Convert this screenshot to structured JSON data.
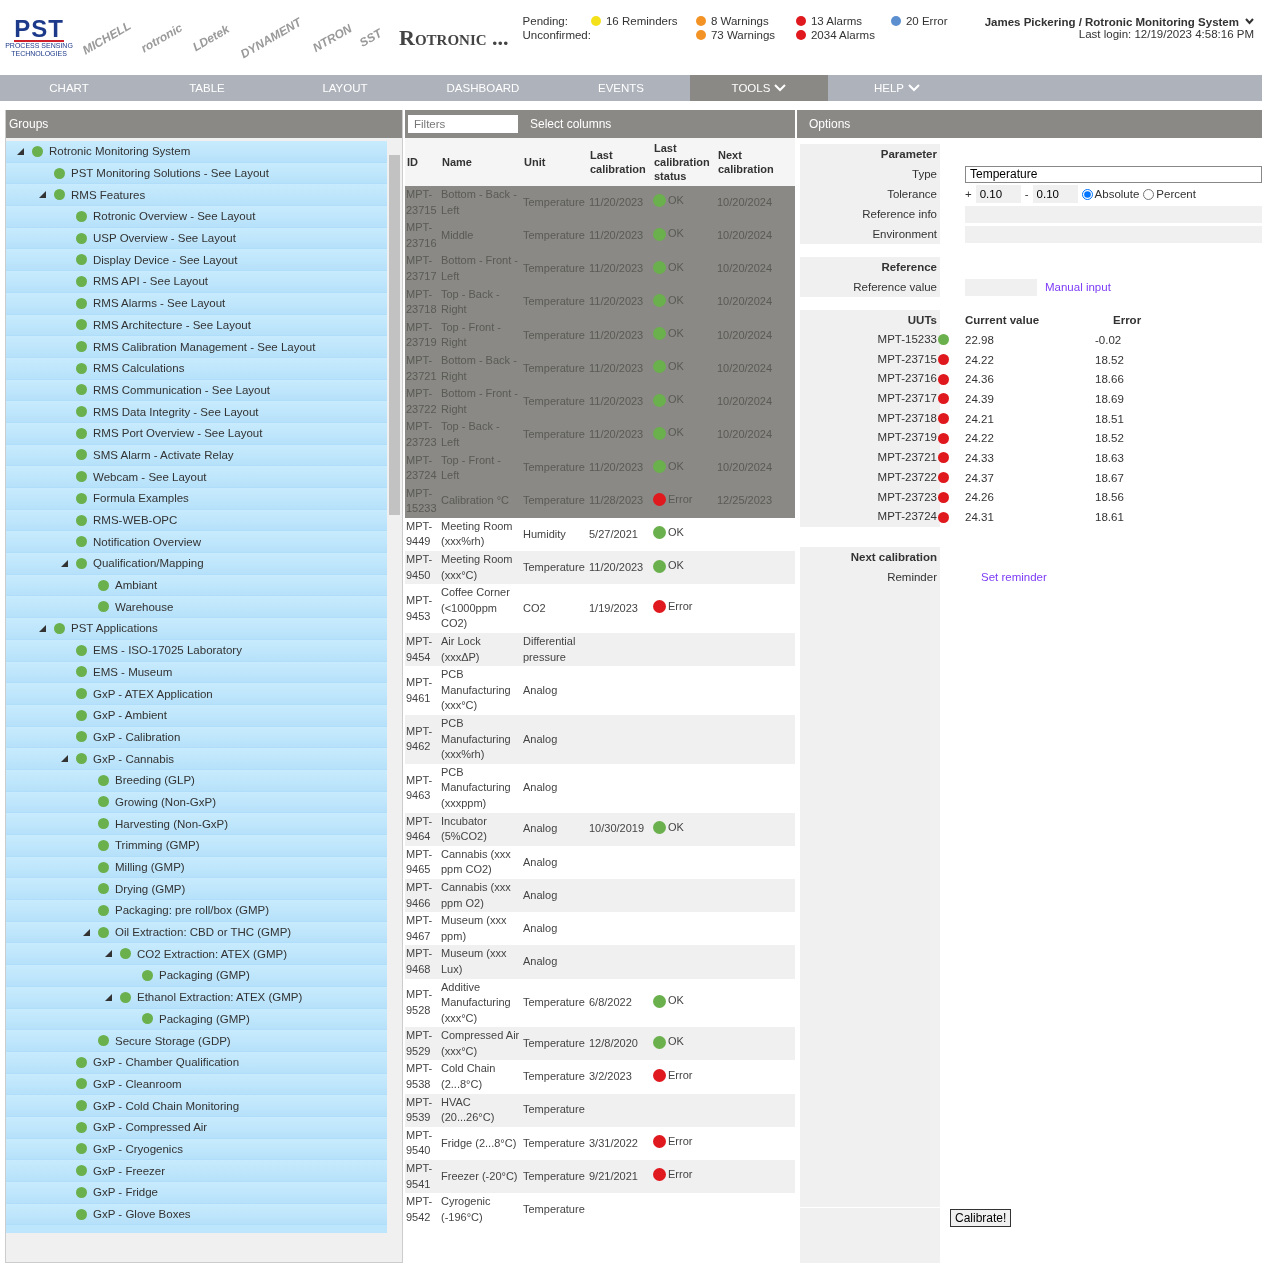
{
  "header": {
    "logos": [
      {
        "text": "PST",
        "sub": "PROCESS SENSING TECHNOLOGIES",
        "kind": "main"
      },
      {
        "text": "MICHELL",
        "kind": "tilt"
      },
      {
        "text": "rotronic",
        "kind": "tilt"
      },
      {
        "text": "LDetek",
        "kind": "tilt"
      },
      {
        "text": "DYNAMENT",
        "kind": "tilt"
      },
      {
        "text": "NTRON",
        "kind": "tilt"
      },
      {
        "text": "SST",
        "kind": "tilt"
      }
    ],
    "title": "Rotronic ...",
    "counters": [
      {
        "label": "Pending:",
        "items": [
          {
            "kind": "reminders",
            "text": "16 Reminders",
            "color": "#f5e11a"
          },
          {
            "kind": "warnings",
            "text": "8 Warnings",
            "color": "#f39325"
          },
          {
            "kind": "alarms",
            "text": "13 Alarms",
            "color": "#e0191e"
          },
          {
            "kind": "errors",
            "text": "20 Error",
            "color": "#5b8fd0"
          }
        ]
      },
      {
        "label": "Unconfirmed:",
        "items": [
          {
            "kind": "warnings",
            "text": "73 Warnings",
            "color": "#f39325"
          },
          {
            "kind": "alarms",
            "text": "2034 Alarms",
            "color": "#e0191e"
          }
        ]
      }
    ],
    "user": "James Pickering / Rotronic Monitoring System",
    "last_login": "Last login: 12/19/2023 4:58:16 PM"
  },
  "nav": [
    {
      "label": "CHART",
      "selected": false
    },
    {
      "label": "TABLE",
      "selected": false
    },
    {
      "label": "LAYOUT",
      "selected": false
    },
    {
      "label": "DASHBOARD",
      "selected": false
    },
    {
      "label": "EVENTS",
      "selected": false
    },
    {
      "label": "TOOLS",
      "selected": true,
      "menu": true
    },
    {
      "label": "HELP",
      "selected": false,
      "menu": true
    }
  ],
  "groups": {
    "title": "Groups",
    "tree": [
      {
        "label": "Rotronic Monitoring System",
        "expanded": true,
        "children": [
          {
            "label": "PST Monitoring Solutions - See Layout"
          },
          {
            "label": "RMS Features",
            "expanded": true,
            "children": [
              {
                "label": "Rotronic Overview - See Layout"
              },
              {
                "label": "USP Overview - See Layout"
              },
              {
                "label": "Display Device - See Layout"
              },
              {
                "label": "RMS API - See Layout"
              },
              {
                "label": "RMS Alarms - See Layout"
              },
              {
                "label": "RMS Architecture - See Layout"
              },
              {
                "label": "RMS Calibration Management - See Layout"
              },
              {
                "label": "RMS Calculations"
              },
              {
                "label": "RMS Communication - See Layout"
              },
              {
                "label": "RMS Data Integrity - See Layout"
              },
              {
                "label": "RMS Port Overview - See Layout"
              },
              {
                "label": "SMS Alarm - Activate Relay"
              },
              {
                "label": "Webcam - See Layout"
              },
              {
                "label": "Formula Examples"
              },
              {
                "label": "RMS-WEB-OPC"
              },
              {
                "label": "Notification Overview"
              },
              {
                "label": "Qualification/Mapping",
                "expanded": true,
                "children": [
                  {
                    "label": "Ambiant"
                  },
                  {
                    "label": "Warehouse"
                  }
                ]
              }
            ]
          },
          {
            "label": "PST Applications",
            "expanded": true,
            "children": [
              {
                "label": "EMS - ISO-17025 Laboratory"
              },
              {
                "label": "EMS - Museum"
              },
              {
                "label": "GxP - ATEX Application"
              },
              {
                "label": "GxP - Ambient"
              },
              {
                "label": "GxP - Calibration"
              },
              {
                "label": "GxP - Cannabis",
                "expanded": true,
                "children": [
                  {
                    "label": "Breeding (GLP)"
                  },
                  {
                    "label": "Growing (Non-GxP)"
                  },
                  {
                    "label": "Harvesting (Non-GxP)"
                  },
                  {
                    "label": "Trimming (GMP)"
                  },
                  {
                    "label": "Milling (GMP)"
                  },
                  {
                    "label": "Drying (GMP)"
                  },
                  {
                    "label": "Packaging: pre roll/box (GMP)"
                  },
                  {
                    "label": "Oil Extraction: CBD or THC (GMP)",
                    "expanded": true,
                    "children": [
                      {
                        "label": "CO2 Extraction: ATEX (GMP)",
                        "expanded": true,
                        "children": [
                          {
                            "label": "Packaging (GMP)"
                          }
                        ]
                      },
                      {
                        "label": "Ethanol Extraction: ATEX (GMP)",
                        "expanded": true,
                        "children": [
                          {
                            "label": "Packaging (GMP)"
                          }
                        ]
                      }
                    ]
                  },
                  {
                    "label": "Secure Storage (GDP)"
                  }
                ]
              },
              {
                "label": "GxP - Chamber Qualification"
              },
              {
                "label": "GxP - Cleanroom"
              },
              {
                "label": "GxP - Cold Chain Monitoring"
              },
              {
                "label": "GxP - Compressed Air"
              },
              {
                "label": "GxP - Cryogenics"
              },
              {
                "label": "GxP - Freezer"
              },
              {
                "label": "GxP - Fridge"
              },
              {
                "label": "GxP - Glove Boxes"
              }
            ]
          }
        ]
      }
    ]
  },
  "table": {
    "filter_placeholder": "Filters",
    "select_columns": "Select columns",
    "columns": [
      "ID",
      "Name",
      "Unit",
      "Last calibration",
      "Last calibration status",
      "Next calibration"
    ],
    "rows": [
      {
        "selected": true,
        "id": "MPT-23715",
        "name": "Bottom - Back - Left",
        "unit": "Temperature",
        "last": "11/20/2023",
        "color": "#6ab04c",
        "status_text": "OK",
        "next": "10/20/2024"
      },
      {
        "selected": true,
        "id": "MPT-23716",
        "name": "Middle",
        "unit": "Temperature",
        "last": "11/20/2023",
        "color": "#6ab04c",
        "status_text": "OK",
        "next": "10/20/2024"
      },
      {
        "selected": true,
        "id": "MPT-23717",
        "name": "Bottom - Front - Left",
        "unit": "Temperature",
        "last": "11/20/2023",
        "color": "#6ab04c",
        "status_text": "OK",
        "next": "10/20/2024"
      },
      {
        "selected": true,
        "id": "MPT-23718",
        "name": "Top - Back - Right",
        "unit": "Temperature",
        "last": "11/20/2023",
        "color": "#6ab04c",
        "status_text": "OK",
        "next": "10/20/2024"
      },
      {
        "selected": true,
        "id": "MPT-23719",
        "name": "Top - Front - Right",
        "unit": "Temperature",
        "last": "11/20/2023",
        "color": "#6ab04c",
        "status_text": "OK",
        "next": "10/20/2024"
      },
      {
        "selected": true,
        "id": "MPT-23721",
        "name": "Bottom - Back - Right",
        "unit": "Temperature",
        "last": "11/20/2023",
        "color": "#6ab04c",
        "status_text": "OK",
        "next": "10/20/2024"
      },
      {
        "selected": true,
        "id": "MPT-23722",
        "name": "Bottom - Front - Right",
        "unit": "Temperature",
        "last": "11/20/2023",
        "color": "#6ab04c",
        "status_text": "OK",
        "next": "10/20/2024"
      },
      {
        "selected": true,
        "id": "MPT-23723",
        "name": "Top - Back - Left",
        "unit": "Temperature",
        "last": "11/20/2023",
        "color": "#6ab04c",
        "status_text": "OK",
        "next": "10/20/2024"
      },
      {
        "selected": true,
        "id": "MPT-23724",
        "name": "Top - Front - Left",
        "unit": "Temperature",
        "last": "11/20/2023",
        "color": "#6ab04c",
        "status_text": "OK",
        "next": "10/20/2024"
      },
      {
        "selected": true,
        "id": "MPT-15233",
        "name": "Calibration °C",
        "unit": "Temperature",
        "last": "11/28/2023",
        "color": "#e0191e",
        "status_text": "Error",
        "next": "12/25/2023"
      },
      {
        "selected": false,
        "id": "MPT-9449",
        "name": "Meeting Room (xxx%rh)",
        "unit": "Humidity",
        "last": "5/27/2021",
        "color": "#6ab04c",
        "status_text": "OK"
      },
      {
        "selected": false,
        "id": "MPT-9450",
        "name": "Meeting Room (xxx°C)",
        "unit": "Temperature",
        "last": "11/20/2023",
        "color": "#6ab04c",
        "status_text": "OK"
      },
      {
        "selected": false,
        "id": "MPT-9453",
        "name": "Coffee Corner (<1000ppm CO2)",
        "unit": "CO2",
        "last": "1/19/2023",
        "color": "#e0191e",
        "status_text": "Error"
      },
      {
        "selected": false,
        "id": "MPT-9454",
        "name": "Air Lock (xxxΔP)",
        "unit": "Differential pressure"
      },
      {
        "selected": false,
        "id": "MPT-9461",
        "name": "PCB Manufacturing (xxx°C)",
        "unit": "Analog"
      },
      {
        "selected": false,
        "id": "MPT-9462",
        "name": "PCB Manufacturing (xxx%rh)",
        "unit": "Analog"
      },
      {
        "selected": false,
        "id": "MPT-9463",
        "name": "PCB Manufacturing (xxxppm)",
        "unit": "Analog"
      },
      {
        "selected": false,
        "id": "MPT-9464",
        "name": "Incubator (5%CO2)",
        "unit": "Analog",
        "last": "10/30/2019",
        "color": "#6ab04c",
        "status_text": "OK"
      },
      {
        "selected": false,
        "id": "MPT-9465",
        "name": "Cannabis (xxx ppm CO2)",
        "unit": "Analog"
      },
      {
        "selected": false,
        "id": "MPT-9466",
        "name": "Cannabis (xxx ppm O2)",
        "unit": "Analog"
      },
      {
        "selected": false,
        "id": "MPT-9467",
        "name": "Museum (xxx ppm)",
        "unit": "Analog"
      },
      {
        "selected": false,
        "id": "MPT-9468",
        "name": "Museum (xxx Lux)",
        "unit": "Analog"
      },
      {
        "selected": false,
        "id": "MPT-9528",
        "name": "Additive Manufacturing (xxx°C)",
        "unit": "Temperature",
        "last": "6/8/2022",
        "color": "#6ab04c",
        "status_text": "OK"
      },
      {
        "selected": false,
        "id": "MPT-9529",
        "name": "Compressed Air (xxx°C)",
        "unit": "Temperature",
        "last": "12/8/2020",
        "color": "#6ab04c",
        "status_text": "OK"
      },
      {
        "selected": false,
        "id": "MPT-9538",
        "name": "Cold Chain (2...8°C)",
        "unit": "Temperature",
        "last": "3/2/2023",
        "color": "#e0191e",
        "status_text": "Error"
      },
      {
        "selected": false,
        "id": "MPT-9539",
        "name": "HVAC (20...26°C)",
        "unit": "Temperature"
      },
      {
        "selected": false,
        "id": "MPT-9540",
        "name": "Fridge (2...8°C)",
        "unit": "Temperature",
        "last": "3/31/2022",
        "color": "#e0191e",
        "status_text": "Error"
      },
      {
        "selected": false,
        "id": "MPT-9541",
        "name": "Freezer (-20°C)",
        "unit": "Temperature",
        "last": "9/21/2021",
        "color": "#e0191e",
        "status_text": "Error"
      },
      {
        "selected": false,
        "id": "MPT-9542",
        "name": "Cyrogenic (-196°C)",
        "unit": "Temperature"
      }
    ]
  },
  "options": {
    "title": "Options",
    "parameter": {
      "heading": "Parameter",
      "type_label": "Type",
      "type_value": "Temperature",
      "tolerance_label": "Tolerance",
      "plus": "+",
      "plus_value": "0.10",
      "minus": "-",
      "minus_value": "0.10",
      "modes": [
        {
          "label": "Absolute",
          "selected": true
        },
        {
          "label": "Percent",
          "selected": false
        }
      ],
      "reference_info_label": "Reference info",
      "environment_label": "Environment"
    },
    "reference": {
      "heading": "Reference",
      "value_label": "Reference value",
      "manual_input": "Manual input"
    },
    "uuts": {
      "heading": "UUTs",
      "current_header": "Current value",
      "error_header": "Error",
      "items": [
        {
          "id": "MPT-15233",
          "color": "#6ab04c",
          "value": "22.98",
          "error": "-0.02"
        },
        {
          "id": "MPT-23715",
          "color": "#e0191e",
          "value": "24.22",
          "error": "18.52"
        },
        {
          "id": "MPT-23716",
          "color": "#e0191e",
          "value": "24.36",
          "error": "18.66"
        },
        {
          "id": "MPT-23717",
          "color": "#e0191e",
          "value": "24.39",
          "error": "18.69"
        },
        {
          "id": "MPT-23718",
          "color": "#e0191e",
          "value": "24.21",
          "error": "18.51"
        },
        {
          "id": "MPT-23719",
          "color": "#e0191e",
          "value": "24.22",
          "error": "18.52"
        },
        {
          "id": "MPT-23721",
          "color": "#e0191e",
          "value": "24.33",
          "error": "18.63"
        },
        {
          "id": "MPT-23722",
          "color": "#e0191e",
          "value": "24.37",
          "error": "18.67"
        },
        {
          "id": "MPT-23723",
          "color": "#e0191e",
          "value": "24.26",
          "error": "18.56"
        },
        {
          "id": "MPT-23724",
          "color": "#e0191e",
          "value": "24.31",
          "error": "18.61"
        }
      ]
    },
    "next": {
      "heading": "Next calibration",
      "reminder_label": "Reminder",
      "set_reminder": "Set reminder"
    },
    "calibrate": "Calibrate!"
  }
}
